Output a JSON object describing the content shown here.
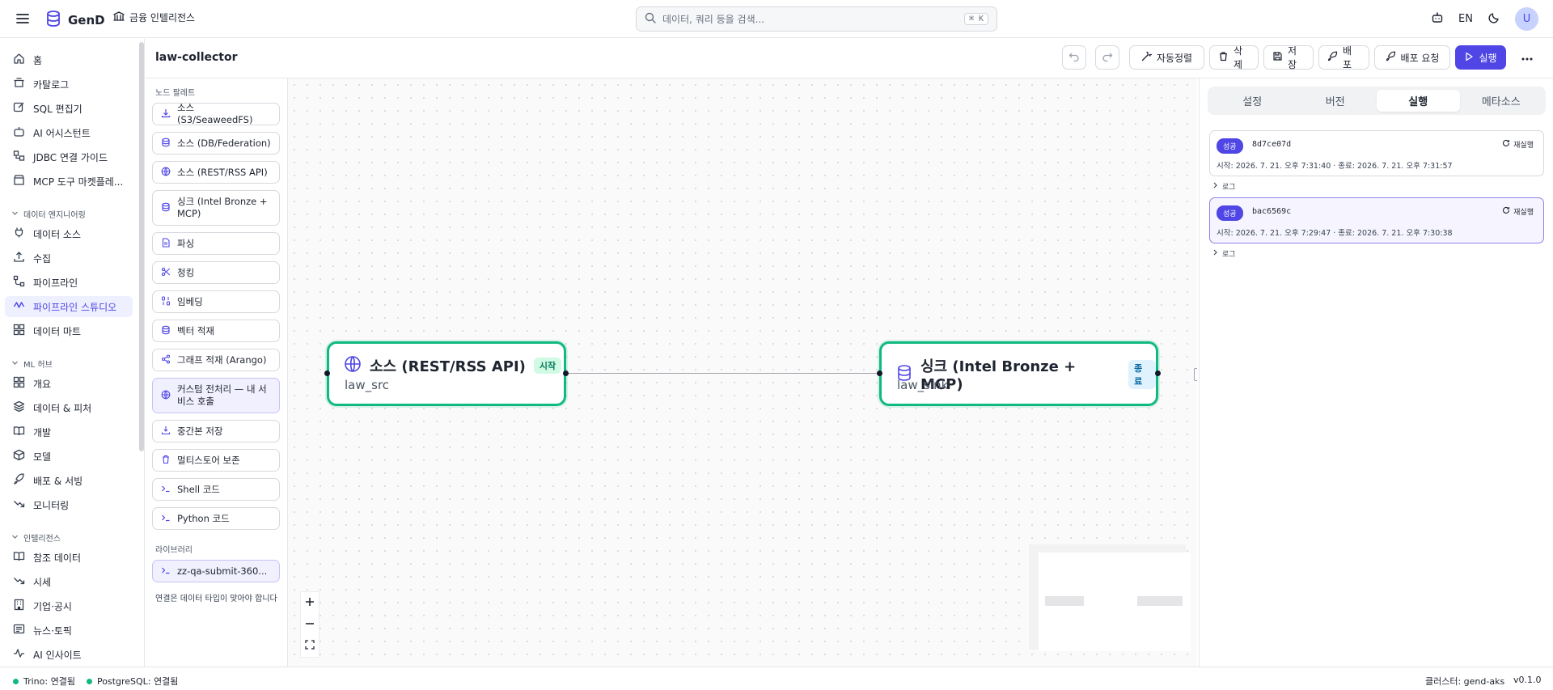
{
  "topbar": {
    "brand": "GenD",
    "workspace": "금융 인텔리전스",
    "search_placeholder": "데이터, 쿼리 등을 검색...",
    "search_shortcut": "⌘ K",
    "language": "EN",
    "avatar_initial": "U"
  },
  "sidebar": {
    "items": [
      {
        "label": "홈",
        "icon": "home-icon"
      },
      {
        "label": "카탈로그",
        "icon": "catalog-icon"
      },
      {
        "label": "SQL 편집기",
        "icon": "edit-icon"
      },
      {
        "label": "AI 어시스턴트",
        "icon": "bot-icon"
      },
      {
        "label": "JDBC 연결 가이드",
        "icon": "plug-guide-icon"
      },
      {
        "label": "MCP 도구 마켓플레...",
        "icon": "store-icon"
      }
    ],
    "section_data_eng": "데이터 엔지니어링",
    "data_eng_items": [
      {
        "label": "데이터 소스",
        "icon": "plug-icon"
      },
      {
        "label": "수집",
        "icon": "upload-icon"
      },
      {
        "label": "파이프라인",
        "icon": "workflow-icon"
      },
      {
        "label": "파이프라인 스튜디오",
        "icon": "studio-icon",
        "active": true
      },
      {
        "label": "데이터 마트",
        "icon": "grid-icon"
      }
    ],
    "section_ml": "ML 허브",
    "ml_items": [
      {
        "label": "개요",
        "icon": "grid-icon"
      },
      {
        "label": "데이터 & 피처",
        "icon": "layers-icon"
      },
      {
        "label": "개발",
        "icon": "book-icon"
      },
      {
        "label": "모델",
        "icon": "box-icon"
      },
      {
        "label": "배포 & 서빙",
        "icon": "rocket-icon"
      },
      {
        "label": "모니터링",
        "icon": "trend-icon"
      }
    ],
    "section_intel": "인텔리전스",
    "intel_items": [
      {
        "label": "참조 데이터",
        "icon": "book-icon"
      },
      {
        "label": "시세",
        "icon": "trend-icon"
      },
      {
        "label": "기업·공시",
        "icon": "building-icon"
      },
      {
        "label": "뉴스·토픽",
        "icon": "news-icon"
      },
      {
        "label": "AI 인사이트",
        "icon": "pulse-icon"
      }
    ]
  },
  "editor": {
    "title": "law-collector",
    "buttons": {
      "auto_layout": "자동정렬",
      "delete": "삭제",
      "save": "저장",
      "deploy": "배포",
      "deploy_request": "배포 요청",
      "run": "실행"
    }
  },
  "palette": {
    "label": "노드 팔레트",
    "items": [
      {
        "label": "소스 (S3/SeaweedFS)",
        "icon": "download-icon"
      },
      {
        "label": "소스 (DB/Federation)",
        "icon": "database-icon"
      },
      {
        "label": "소스 (REST/RSS API)",
        "icon": "globe-icon"
      },
      {
        "label": "싱크 (Intel Bronze + MCP)",
        "icon": "database-icon"
      },
      {
        "label": "파싱",
        "icon": "file-icon"
      },
      {
        "label": "청킹",
        "icon": "scissors-icon"
      },
      {
        "label": "임베딩",
        "icon": "binary-icon"
      },
      {
        "label": "벡터 적재",
        "icon": "database-icon"
      },
      {
        "label": "그래프 적재 (Arango)",
        "icon": "share-icon"
      },
      {
        "label": "커스텀 전처리 — 내 서비스 호출",
        "icon": "globe-icon"
      },
      {
        "label": "중간본 저장",
        "icon": "save-down-icon"
      },
      {
        "label": "멀티스토어 보존",
        "icon": "trash-icon"
      },
      {
        "label": "Shell 코드",
        "icon": "terminal-icon"
      },
      {
        "label": "Python 코드",
        "icon": "terminal-icon"
      }
    ],
    "library_label": "라이브러리",
    "library_items": [
      {
        "label": "zz-qa-submit-360...",
        "icon": "terminal-icon"
      }
    ],
    "hint": "연결은 데이터 타입이 맞아야 합니다"
  },
  "canvas": {
    "nodes": [
      {
        "title": "소스 (REST/RSS API)",
        "badge": "시작",
        "sub": "law_src",
        "icon": "globe-icon"
      },
      {
        "title": "싱크 (Intel Bronze + MCP)",
        "badge": "종료",
        "sub": "law_sink",
        "icon": "database-icon"
      }
    ]
  },
  "right_panel": {
    "tabs": [
      "설정",
      "버전",
      "실행",
      "메타소스"
    ],
    "active_tab": "실행",
    "runs": [
      {
        "status": "성공",
        "id": "8d7ce07d",
        "rerun": "재실행",
        "times": "시작: 2026. 7. 21. 오후 7:31:40 · 종료: 2026. 7. 21. 오후 7:31:57",
        "log": "로그"
      },
      {
        "status": "성공",
        "id": "bac6569c",
        "rerun": "재실행",
        "times": "시작: 2026. 7. 21. 오후 7:29:47 · 종료: 2026. 7. 21. 오후 7:30:38",
        "log": "로그"
      }
    ]
  },
  "statusbar": {
    "trino": "Trino: 연결됨",
    "postgres": "PostgreSQL: 연결됨",
    "cluster": "클러스터: gend-aks",
    "version": "v0.1.0"
  },
  "colors": {
    "accent": "#4f46e5",
    "node_border": "#10b981",
    "status_ok": "#10b981"
  }
}
